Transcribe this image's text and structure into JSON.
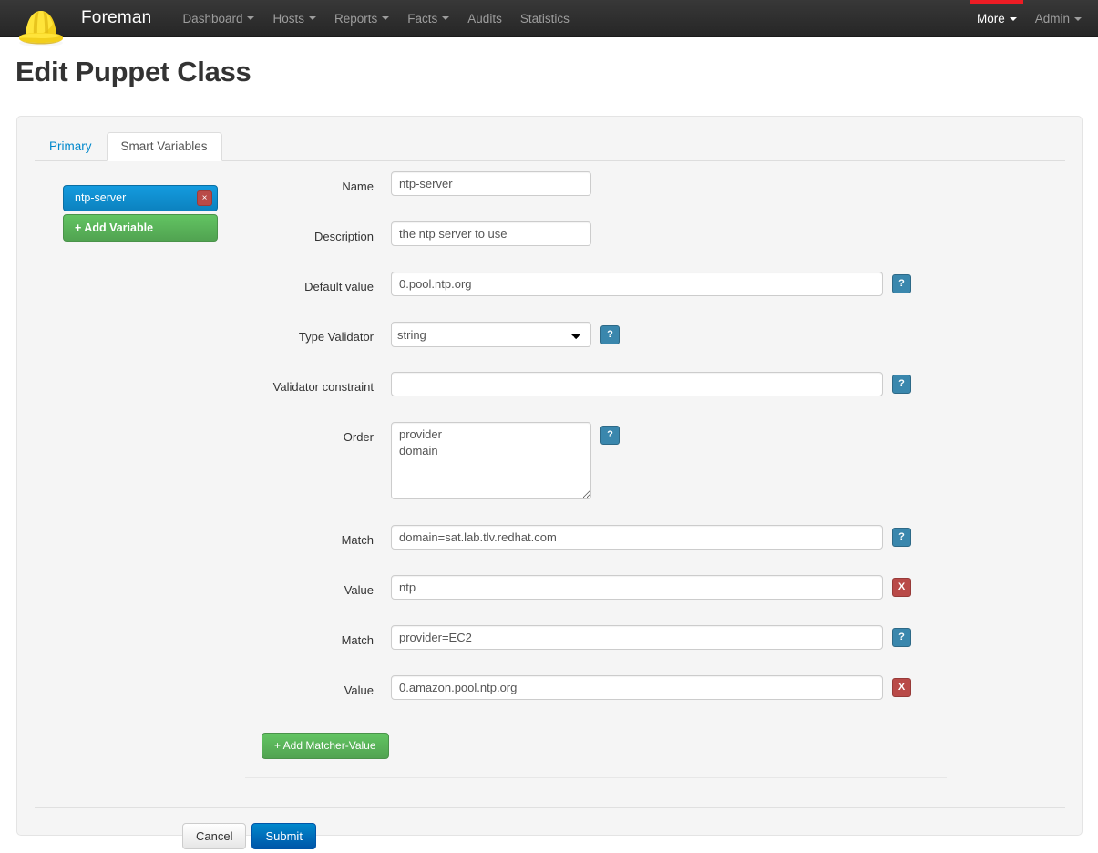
{
  "navbar": {
    "brand": "Foreman",
    "logo_icon": "hardhat-icon",
    "items": [
      {
        "label": "Dashboard",
        "caret": true
      },
      {
        "label": "Hosts",
        "caret": true
      },
      {
        "label": "Reports",
        "caret": true
      },
      {
        "label": "Facts",
        "caret": true
      },
      {
        "label": "Audits",
        "caret": false
      },
      {
        "label": "Statistics",
        "caret": false
      }
    ],
    "right_items": [
      {
        "label": "More",
        "caret": true,
        "marker": true
      },
      {
        "label": "Admin",
        "caret": true,
        "marker": false
      }
    ],
    "marker_color": "#ed1c24",
    "background": "#2d2d2d"
  },
  "page": {
    "title": "Edit Puppet Class"
  },
  "tabs": [
    {
      "label": "Primary",
      "active": false
    },
    {
      "label": "Smart Variables",
      "active": true
    }
  ],
  "variables": {
    "items": [
      {
        "label": "ntp-server",
        "delete_label": "×",
        "active": true
      }
    ],
    "add_label": "+ Add Variable",
    "active_color": "#0e90d2",
    "add_color": "#5bb75b",
    "delete_color": "#b94a48"
  },
  "form": {
    "name": {
      "label": "Name",
      "value": "ntp-server"
    },
    "description": {
      "label": "Description",
      "value": "the ntp server to use"
    },
    "default_value": {
      "label": "Default value",
      "value": "0.pool.ntp.org",
      "help": "?"
    },
    "type_validator": {
      "label": "Type Validator",
      "value": "string",
      "options": [
        "string"
      ],
      "help": "?"
    },
    "validator_constraint": {
      "label": "Validator constraint",
      "value": "",
      "help": "?"
    },
    "order": {
      "label": "Order",
      "value": "provider\ndomain",
      "help": "?"
    },
    "matchers": [
      {
        "match_label": "Match",
        "match_value": "domain=sat.lab.tlv.redhat.com",
        "match_help": "?",
        "value_label": "Value",
        "value_value": "ntp",
        "remove_label": "X"
      },
      {
        "match_label": "Match",
        "match_value": "provider=EC2",
        "match_help": "?",
        "value_label": "Value",
        "value_value": "0.amazon.pool.ntp.org",
        "remove_label": "X"
      }
    ],
    "add_matcher_label": "+ Add Matcher-Value"
  },
  "actions": {
    "cancel_label": "Cancel",
    "submit_label": "Submit",
    "submit_color": "#0074cc"
  }
}
